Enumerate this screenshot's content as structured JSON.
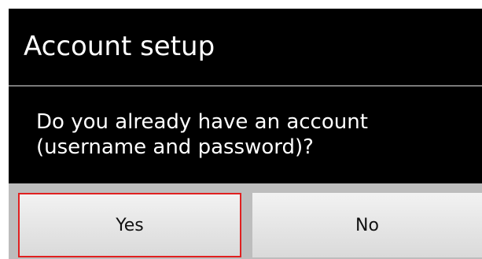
{
  "dialog": {
    "title": "Account setup",
    "message_line1": "Do you already have an account",
    "message_line2": "(username and password)?",
    "buttons": {
      "yes_label": "Yes",
      "no_label": "No"
    },
    "colors": {
      "background": "#000000",
      "text": "#ffffff",
      "button_bar": "#bdbdbd",
      "highlight": "#e02020"
    }
  }
}
